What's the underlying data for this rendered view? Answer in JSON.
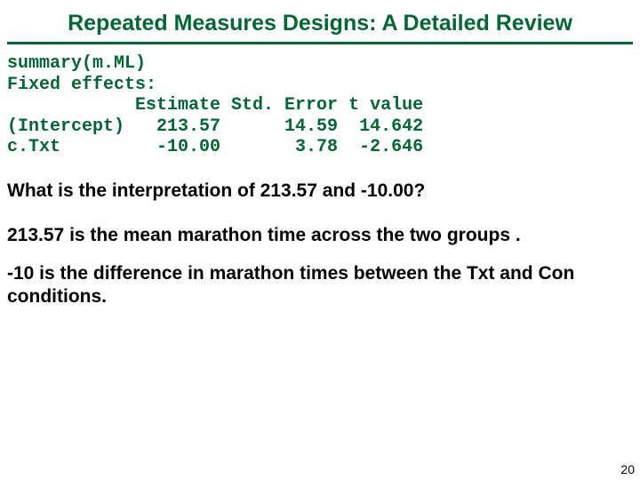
{
  "title": "Repeated Measures Designs: A Detailed Review",
  "code": {
    "l1": "summary(m.ML)",
    "l2": "Fixed effects:",
    "l3": "            Estimate Std. Error t value",
    "l4": "(Intercept)   213.57      14.59  14.642",
    "l5": "c.Txt         -10.00       3.78  -2.646"
  },
  "q": "What is the interpretation of 213.57 and -10.00?",
  "a1": "213.57 is the mean marathon time across the two groups .",
  "a2": "-10 is the difference in marathon times between the Txt and Con conditions.",
  "page": "20"
}
